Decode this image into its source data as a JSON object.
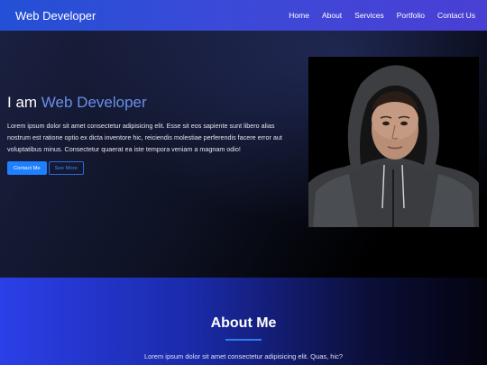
{
  "navbar": {
    "brand": "Web Developer",
    "links": [
      "Home",
      "About",
      "Services",
      "Portfolio",
      "Contact Us"
    ]
  },
  "hero": {
    "title_prefix": "I am ",
    "title_accent": "Web Developer",
    "description": "Lorem ipsum dolor sit amet consectetur adipisicing elit. Esse sit eos sapiente sunt libero alias nostrum est ratione optio ex dicta inventore hic, reiciendis molestiae perferendis facere error aut voluptatibus minus. Consectetur quaerat ea iste tempora veniam a magnam odio!",
    "contact_label": "Contact Me",
    "more_label": "See More"
  },
  "about": {
    "title": "About Me",
    "description": "Lorem ipsum dolor sit amet consectetur adipisicing elit. Quas, hic?"
  },
  "colors": {
    "accent": "#6b8fe8",
    "primary_button": "#1e7fff",
    "navbar_start": "#2350d6",
    "navbar_end": "#4a3fd4"
  }
}
